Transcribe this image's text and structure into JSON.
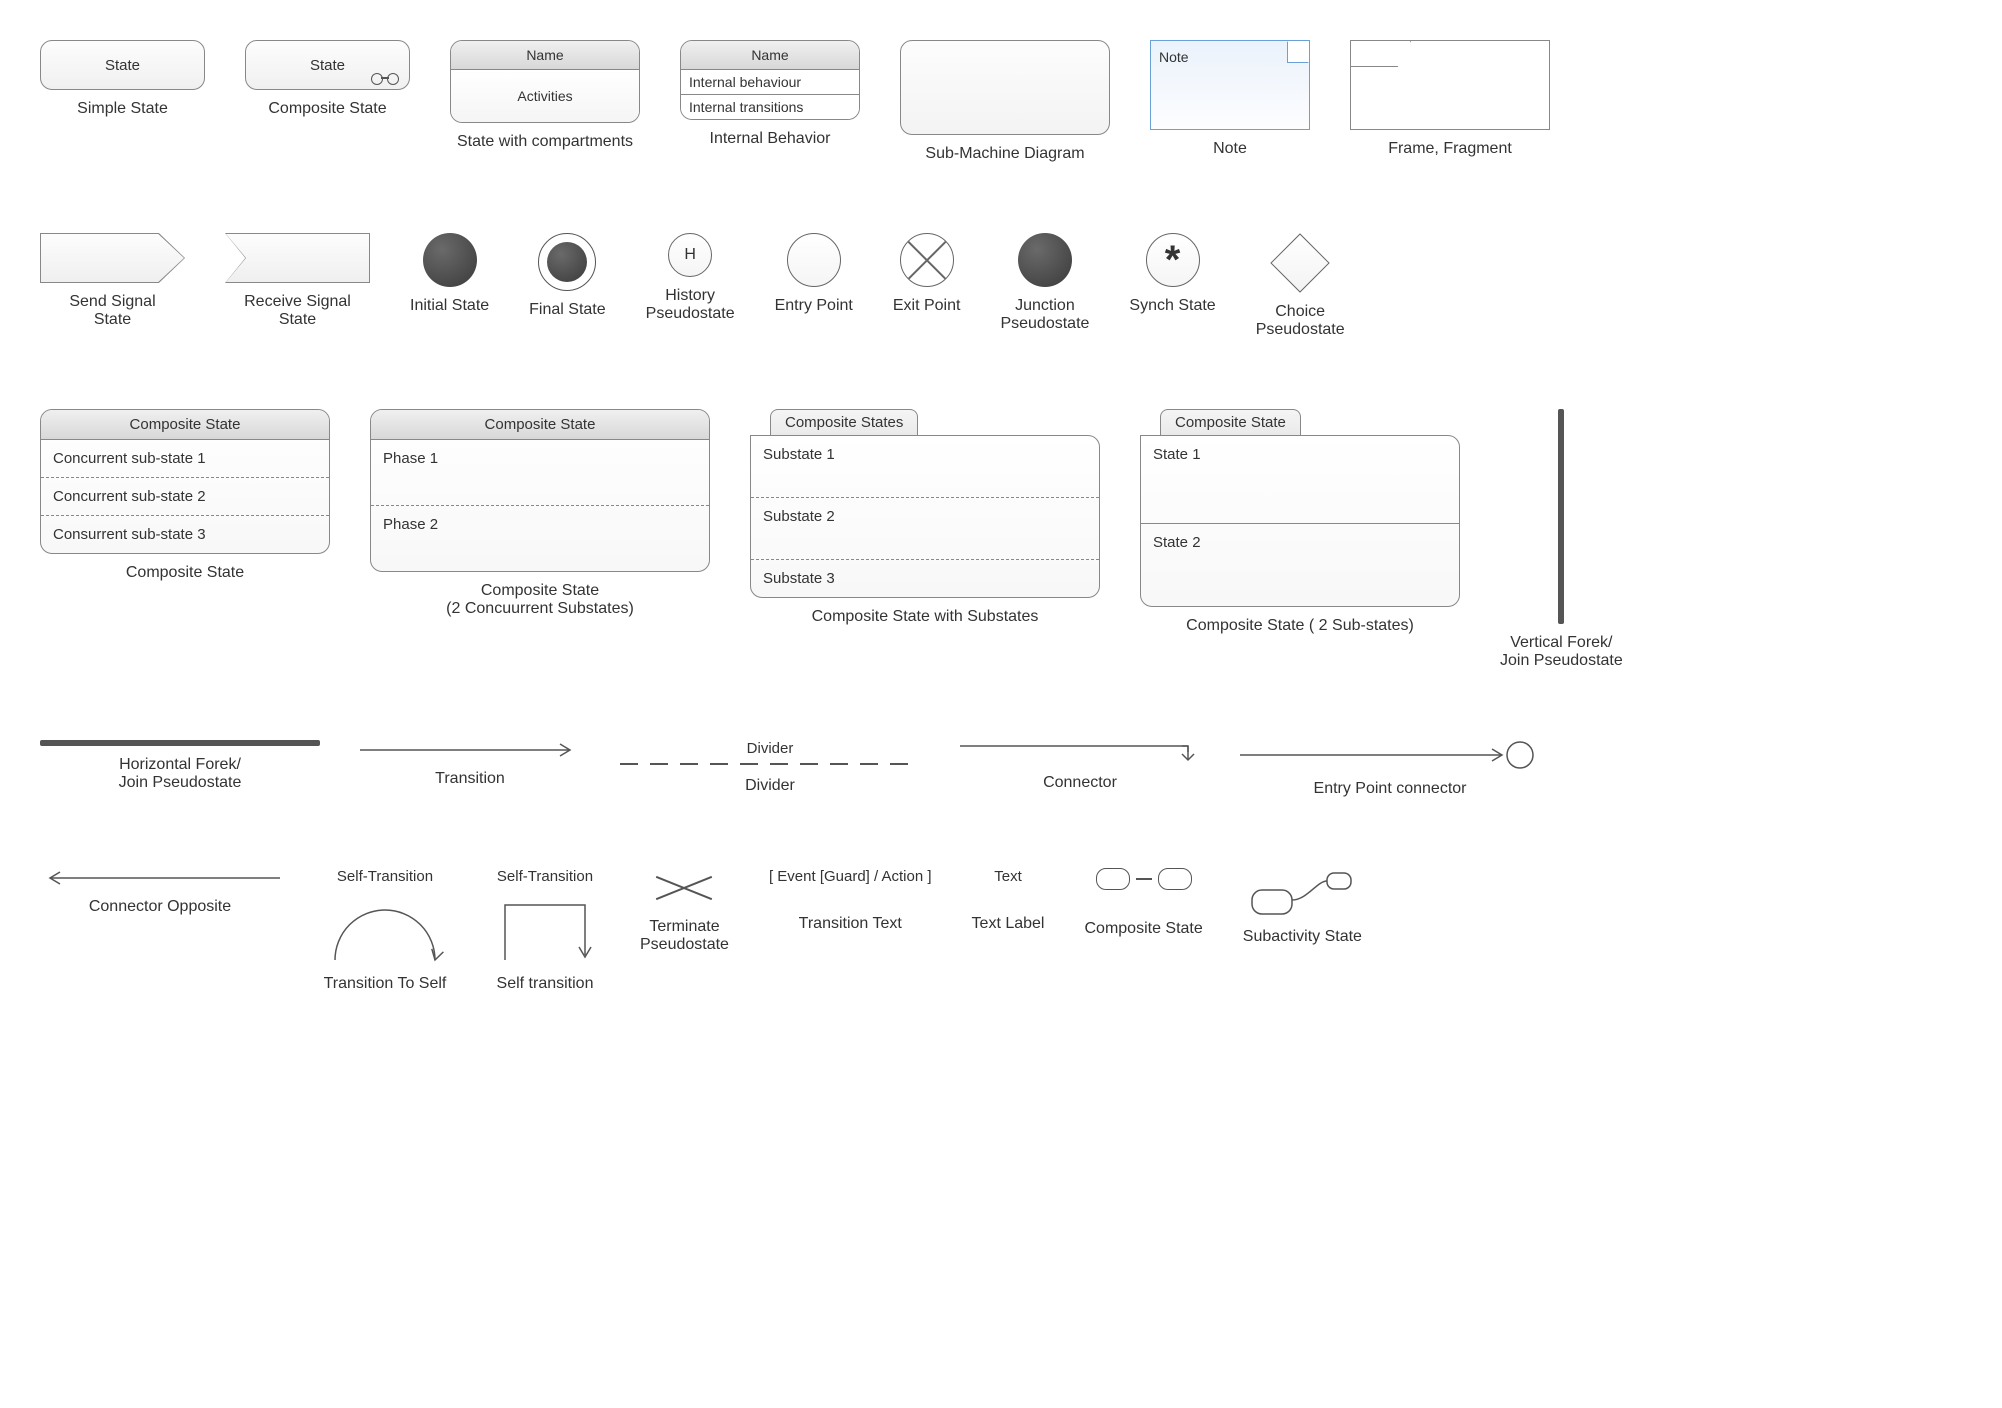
{
  "row1": {
    "simple_state": {
      "label": "State",
      "caption": "Simple State"
    },
    "composite_state": {
      "label": "State",
      "caption": "Composite State"
    },
    "compartments": {
      "name": "Name",
      "activities": "Activities",
      "caption": "State with compartments"
    },
    "internal_behavior": {
      "name": "Name",
      "r1": "Internal behaviour",
      "r2": "Internal transitions",
      "caption": "Internal Behavior"
    },
    "sub_machine": {
      "caption": "Sub-Machine Diagram"
    },
    "note": {
      "text": "Note",
      "caption": "Note"
    },
    "frame": {
      "caption": "Frame, Fragment"
    }
  },
  "row2": {
    "send_signal": "Send Signal\nState",
    "receive_signal": "Receive Signal\nState",
    "initial": "Initial State",
    "final": "Final State",
    "history": {
      "glyph": "H",
      "caption": "History\nPseudostate"
    },
    "entry": "Entry Point",
    "exit": "Exit Point",
    "junction": "Junction\nPseudostate",
    "synch": {
      "glyph": "*",
      "caption": "Synch State"
    },
    "choice": "Choice\nPseudostate"
  },
  "row3": {
    "comp3": {
      "title": "Composite State",
      "r1": "Concurrent sub-state 1",
      "r2": "Concurrent sub-state 2",
      "r3": "Consurrent sub-state 3",
      "caption": "Composite State"
    },
    "comp2": {
      "title": "Composite State",
      "r1": "Phase 1",
      "r2": "Phase 2",
      "caption": "Composite State\n(2 Concuurrent Substates)"
    },
    "comp_sub": {
      "tab": "Composite States",
      "r1": "Substate 1",
      "r2": "Substate 2",
      "r3": "Substate 3",
      "caption": "Composite State with Substates"
    },
    "comp_two": {
      "tab": "Composite State",
      "r1": "State 1",
      "r2": "State 2",
      "caption": "Composite State ( 2 Sub-states)"
    },
    "vfork": "Vertical Forek/\nJoin Pseudostate"
  },
  "row4": {
    "hfork": "Horizontal Forek/\nJoin Pseudostate",
    "transition": "Transition",
    "divider": {
      "label": "Divider",
      "caption": "Divider"
    },
    "connector": "Connector",
    "entry_conn": "Entry Point connector"
  },
  "row5": {
    "conn_opp": "Connector Opposite",
    "self1": {
      "label": "Self-Transition",
      "caption": "Transition To Self"
    },
    "self2": {
      "label": "Self-Transition",
      "caption": "Self transition"
    },
    "terminate": "Terminate\nPseudostate",
    "trans_text": {
      "expr": "[ Event [Guard] / Action ]",
      "caption": "Transition Text"
    },
    "text_label": {
      "word": "Text",
      "caption": "Text Label"
    },
    "comp_mini": "Composite State",
    "subact": "Subactivity State"
  }
}
